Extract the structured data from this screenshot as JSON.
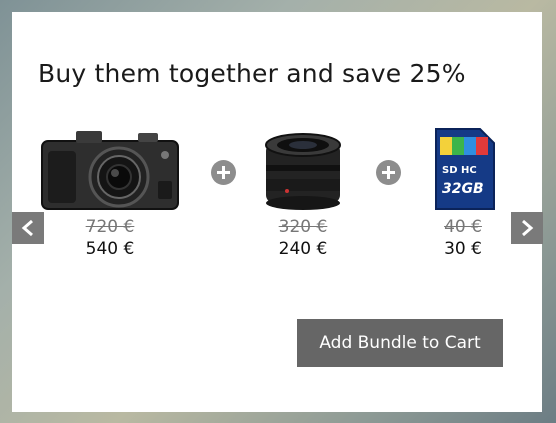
{
  "bundle": {
    "title": "Buy them together and save 25%",
    "products": [
      {
        "icon": "camera-icon",
        "price_old": "720 €",
        "price_new": "540 €"
      },
      {
        "icon": "camera-lens-icon",
        "price_old": "320 €",
        "price_new": "240 €"
      },
      {
        "icon": "sd-card-icon",
        "price_old": "40 €",
        "price_new": "30 €",
        "card_label": "32GB"
      }
    ],
    "cta_label": "Add Bundle to Cart"
  },
  "colors": {
    "cta_bg": "#666666",
    "arrow_bg": "#7a7a7a",
    "plus_bg": "#8d8d8d",
    "panel_bg": "#ffffff"
  }
}
